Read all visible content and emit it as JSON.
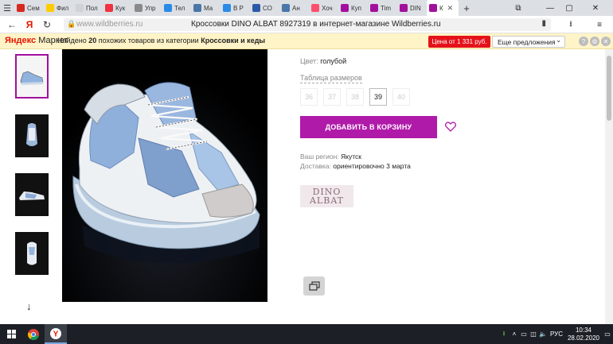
{
  "tabs": [
    {
      "label": "Сем",
      "fav_color": "#d7281f"
    },
    {
      "label": "Фил",
      "fav_color": "#ffcc00"
    },
    {
      "label": "Пол",
      "fav_color": "#cfd3d8"
    },
    {
      "label": "Кук",
      "fav_color": "#ef3340"
    },
    {
      "label": "Упр",
      "fav_color": "#8a8a8a"
    },
    {
      "label": "Тел",
      "fav_color": "#2a8be6"
    },
    {
      "label": "Ма",
      "fav_color": "#4a76a8"
    },
    {
      "label": "В Р",
      "fav_color": "#2a8be6"
    },
    {
      "label": "СО",
      "fav_color": "#2a5aa8"
    },
    {
      "label": "Ан",
      "fav_color": "#4a76a8"
    },
    {
      "label": "Хоч",
      "fav_color": "#ff4d6d"
    },
    {
      "label": "Куп",
      "fav_color": "#a20f9d"
    },
    {
      "label": "Tim",
      "fav_color": "#a20f9d"
    },
    {
      "label": "DIN",
      "fav_color": "#a20f9d"
    },
    {
      "label": "К",
      "fav_color": "#a20f9d",
      "active": true
    }
  ],
  "address": {
    "host": "www.wildberries.ru",
    "title": "Кроссовки DINO ALBAT 8927319 в интернет-магазине Wildberries.ru"
  },
  "yandex_market": {
    "logo_bold": "Яндекс",
    "logo_rest": "Маркет",
    "text_prefix": "Найдено ",
    "count": "20",
    "text_mid": " похожих товаров из категории ",
    "category": "Кроссовки и кеды",
    "price_badge": "Цена от 1 331 руб.",
    "more": "Еще предложения"
  },
  "product": {
    "color_label": "Цвет:",
    "color_value": "голубой",
    "size_table": "Таблица размеров",
    "sizes": [
      {
        "label": "36",
        "available": false
      },
      {
        "label": "37",
        "available": false
      },
      {
        "label": "38",
        "available": false
      },
      {
        "label": "39",
        "available": true
      },
      {
        "label": "40",
        "available": false
      }
    ],
    "add_to_cart": "ДОБАВИТЬ В КОРЗИНУ",
    "region_label": "Ваш регион:",
    "region_value": "Якутск",
    "delivery_label": "Доставка:",
    "delivery_value": "ориентировочно 3 марта",
    "brand_line1": "DINO",
    "brand_line2": "ALBAT"
  },
  "taskbar": {
    "lang": "РУС",
    "time": "10:34",
    "date": "28.02.2020"
  },
  "colors": {
    "accent": "#b01aa9",
    "yandex_bar": "#fff4c7",
    "price_red": "#e5121a"
  }
}
